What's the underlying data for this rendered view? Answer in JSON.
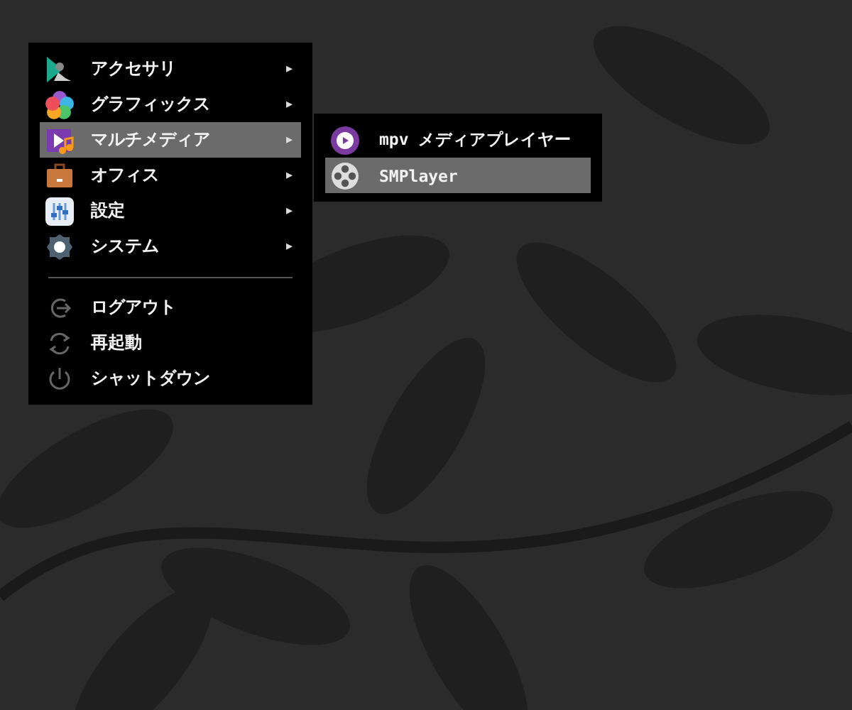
{
  "main_menu": {
    "items": [
      {
        "kind": "submenu",
        "label": "アクセサリ",
        "arrow": "▸",
        "selected": false
      },
      {
        "kind": "submenu",
        "label": "グラフィックス",
        "arrow": "▸",
        "selected": false
      },
      {
        "kind": "submenu",
        "label": "マルチメディア",
        "arrow": "▸",
        "selected": true
      },
      {
        "kind": "submenu",
        "label": "オフィス",
        "arrow": "▸",
        "selected": false
      },
      {
        "kind": "submenu",
        "label": "設定",
        "arrow": "▸",
        "selected": false
      },
      {
        "kind": "submenu",
        "label": "システム",
        "arrow": "▸",
        "selected": false
      },
      {
        "kind": "separator"
      },
      {
        "kind": "action",
        "label": "ログアウト",
        "selected": false
      },
      {
        "kind": "action",
        "label": "再起動",
        "selected": false
      },
      {
        "kind": "action",
        "label": "シャットダウン",
        "selected": false
      }
    ]
  },
  "submenu": {
    "items": [
      {
        "label": "mpv メディアプレイヤー",
        "selected": false
      },
      {
        "label": "SMPlayer",
        "selected": true
      }
    ]
  }
}
